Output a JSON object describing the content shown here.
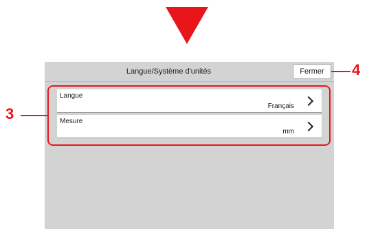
{
  "screen": {
    "title": "Langue/Système d'unités",
    "close_label": "Fermer"
  },
  "settings": [
    {
      "label": "Langue",
      "value": "Français"
    },
    {
      "label": "Mesure",
      "value": "mm"
    }
  ],
  "callouts": {
    "list": "3",
    "close": "4"
  },
  "colors": {
    "accent": "#e8151b",
    "panel": "#d3d3d3"
  },
  "icons": {
    "arrow": "arrow-down-icon",
    "row_action": "chevron-right-icon"
  }
}
